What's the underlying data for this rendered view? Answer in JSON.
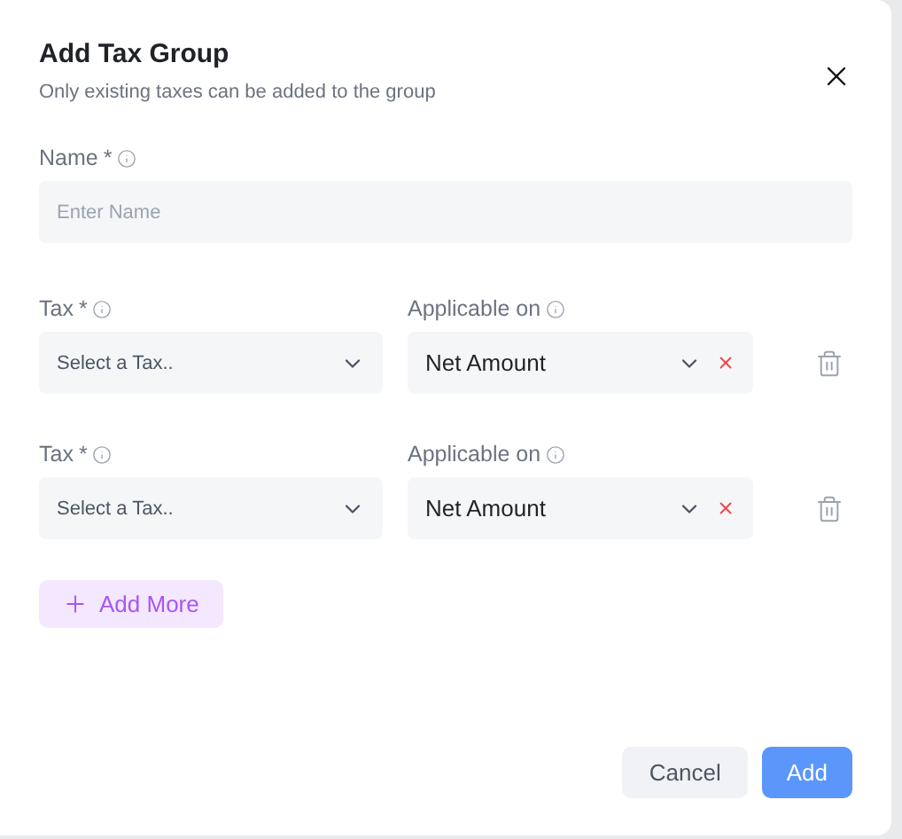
{
  "dialog": {
    "title": "Add Tax Group",
    "subtitle": "Only existing taxes can be added to the group"
  },
  "name_field": {
    "label": "Name",
    "required_mark": "*",
    "placeholder": "Enter Name"
  },
  "tax_rows": [
    {
      "tax_label": "Tax",
      "required_mark": "*",
      "tax_placeholder": "Select a Tax..",
      "applicable_label": "Applicable on",
      "applicable_value": "Net Amount"
    },
    {
      "tax_label": "Tax",
      "required_mark": "*",
      "tax_placeholder": "Select a Tax..",
      "applicable_label": "Applicable on",
      "applicable_value": "Net Amount"
    }
  ],
  "add_more_button": "Add More",
  "buttons": [
    {
      "label": "Cancel",
      "kind": "secondary"
    },
    {
      "label": "Add",
      "kind": "primary"
    }
  ]
}
